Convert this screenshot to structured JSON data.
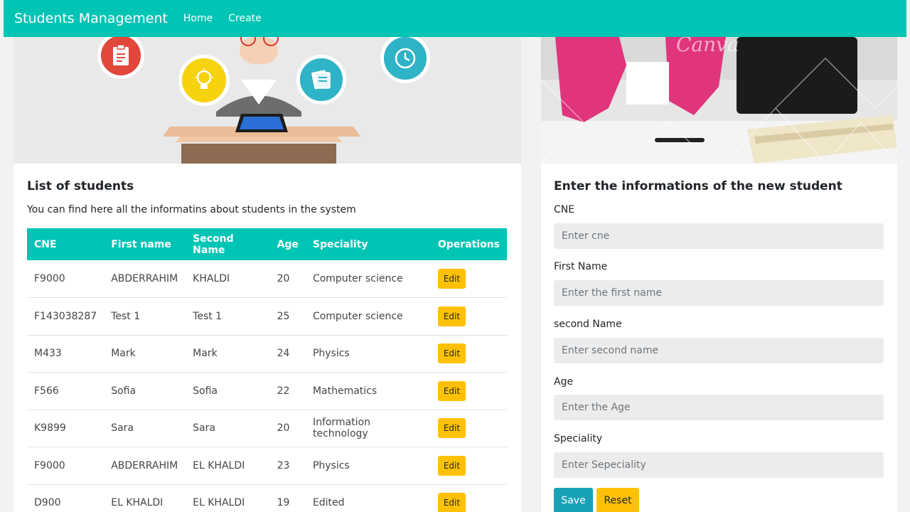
{
  "navbar": {
    "brand": "Students Management",
    "links": [
      "Home",
      "Create"
    ]
  },
  "list": {
    "title": "List of students",
    "subtitle": "You can find here all the informatins about students in the system",
    "columns": [
      "CNE",
      "First name",
      "Second Name",
      "Age",
      "Speciality",
      "Operations"
    ],
    "edit_label": "Edit",
    "rows": [
      {
        "cne": "F9000",
        "first": "ABDERRAHIM",
        "second": "KHALDI",
        "age": "20",
        "speciality": "Computer science"
      },
      {
        "cne": "F143038287",
        "first": "Test 1",
        "second": "Test 1",
        "age": "25",
        "speciality": "Computer science"
      },
      {
        "cne": "M433",
        "first": "Mark",
        "second": "Mark",
        "age": "24",
        "speciality": "Physics"
      },
      {
        "cne": "F566",
        "first": "Sofia",
        "second": "Sofia",
        "age": "22",
        "speciality": "Mathematics"
      },
      {
        "cne": "K9899",
        "first": "Sara",
        "second": "Sara",
        "age": "20",
        "speciality": "Information technology"
      },
      {
        "cne": "F9000",
        "first": "ABDERRAHIM",
        "second": "EL KHALDI",
        "age": "23",
        "speciality": "Physics"
      },
      {
        "cne": "D900",
        "first": "EL KHALDI",
        "second": "EL KHALDI",
        "age": "19",
        "speciality": "Edited"
      }
    ]
  },
  "form": {
    "title": "Enter the informations of the new student",
    "fields": [
      {
        "label": "CNE",
        "placeholder": "Enter cne"
      },
      {
        "label": "First Name",
        "placeholder": "Enter the first name"
      },
      {
        "label": "second Name",
        "placeholder": "Enter second name"
      },
      {
        "label": "Age",
        "placeholder": "Enter the Age"
      },
      {
        "label": "Speciality",
        "placeholder": "Enter Sepeciality"
      }
    ],
    "save_label": "Save",
    "reset_label": "Reset"
  },
  "colors": {
    "primary": "#00c4b4",
    "info": "#17a2b8",
    "warning": "#ffc107"
  },
  "icons": [
    "clipboard-icon",
    "lightbulb-icon",
    "books-icon",
    "clock-icon"
  ]
}
